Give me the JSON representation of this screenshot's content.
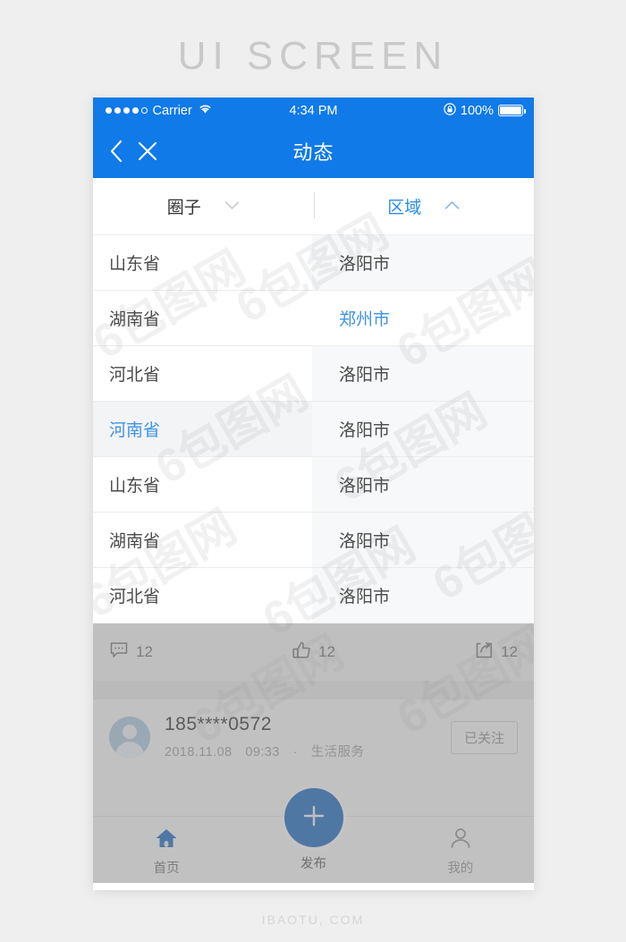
{
  "page": {
    "title": "UI SCREEN",
    "footer": "IBAOTU, COM"
  },
  "colors": {
    "brand_blue": "#0f7ae8",
    "accent_blue": "#3d93e5",
    "fab_blue": "#1363bd",
    "background": "#efefef"
  },
  "status_bar": {
    "carrier": "Carrier",
    "time": "4:34 PM",
    "battery_percent": "100%",
    "signal_dots_filled": 4,
    "signal_dots_total": 5,
    "wifi_icon": "wifi-icon",
    "lock_icon": "rotation-lock-icon",
    "battery_icon": "battery-full-icon"
  },
  "navbar": {
    "title": "动态",
    "back_icon": "chevron-left-icon",
    "close_icon": "close-icon"
  },
  "filter_bar": {
    "left": {
      "label": "圈子",
      "icon": "chevron-down-icon",
      "active": false
    },
    "right": {
      "label": "区域",
      "icon": "chevron-up-icon",
      "active": true
    }
  },
  "dropdown": {
    "provinces": [
      {
        "label": "山东省",
        "selected": false
      },
      {
        "label": "湖南省",
        "selected": false
      },
      {
        "label": "河北省",
        "selected": false
      },
      {
        "label": "河南省",
        "selected": true
      },
      {
        "label": "山东省",
        "selected": false
      },
      {
        "label": "湖南省",
        "selected": false
      },
      {
        "label": "河北省",
        "selected": false
      }
    ],
    "cities": [
      {
        "label": "洛阳市",
        "selected": false
      },
      {
        "label": "郑州市",
        "selected": true
      },
      {
        "label": "洛阳市",
        "selected": false
      },
      {
        "label": "洛阳市",
        "selected": false
      },
      {
        "label": "洛阳市",
        "selected": false
      },
      {
        "label": "洛阳市",
        "selected": false
      },
      {
        "label": "洛阳市",
        "selected": false
      }
    ]
  },
  "action_bar": {
    "comment": {
      "icon": "comment-icon",
      "count": "12"
    },
    "like": {
      "icon": "thumbs-up-icon",
      "count": "12"
    },
    "share": {
      "icon": "share-icon",
      "count": "12"
    }
  },
  "user_card": {
    "avatar_icon": "avatar-placeholder-icon",
    "name": "185****0572",
    "meta": "2018.11.08　09:33　·　生活服务",
    "follow_button": "已关注"
  },
  "tabbar": {
    "items": [
      {
        "label": "首页",
        "icon": "home-icon",
        "active": true
      },
      {
        "label": "发布",
        "icon": "plus-icon",
        "active": false
      },
      {
        "label": "我的",
        "icon": "person-icon",
        "active": false
      }
    ]
  }
}
